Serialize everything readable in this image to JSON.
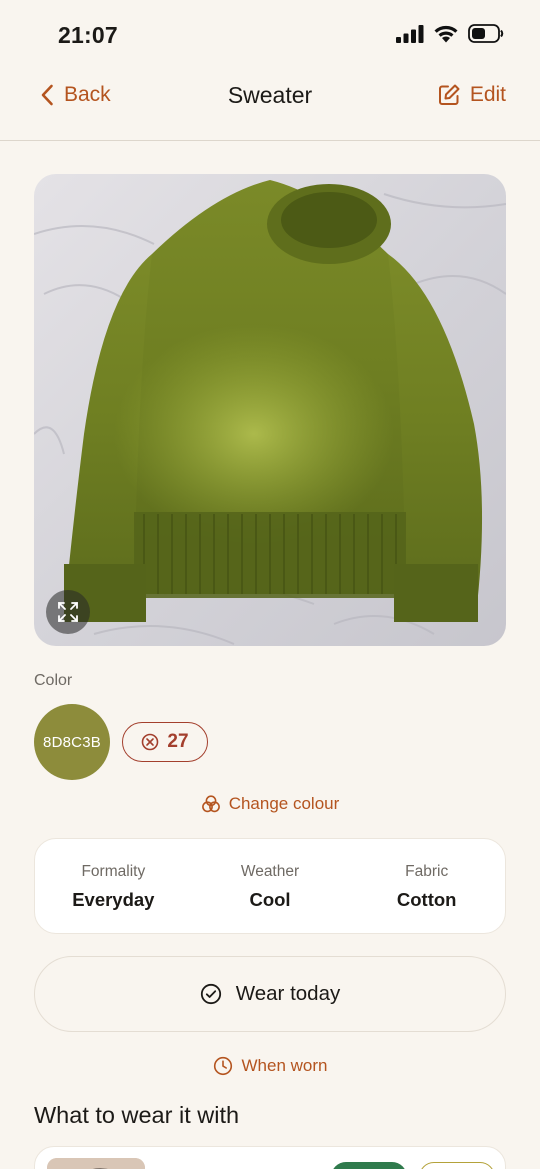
{
  "status_bar": {
    "time": "21:07"
  },
  "nav": {
    "back_label": "Back",
    "title": "Sweater",
    "edit_label": "Edit"
  },
  "item": {
    "photo_icon": "expand-icon"
  },
  "color": {
    "label": "Color",
    "hex_label": "8D8C3B",
    "swatch_color": "#8d8c3b",
    "delta_count": "27",
    "change_label": "Change colour"
  },
  "attributes": [
    {
      "label": "Formality",
      "value": "Everyday"
    },
    {
      "label": "Weather",
      "value": "Cool"
    },
    {
      "label": "Fabric",
      "value": "Cotton"
    }
  ],
  "actions": {
    "wear_today": "Wear today",
    "when_worn": "When worn"
  },
  "section": {
    "title": "What to wear it with"
  },
  "colors": {
    "accent": "#b4541f",
    "delta": "#a33f2d",
    "background": "#f9f5ef"
  }
}
